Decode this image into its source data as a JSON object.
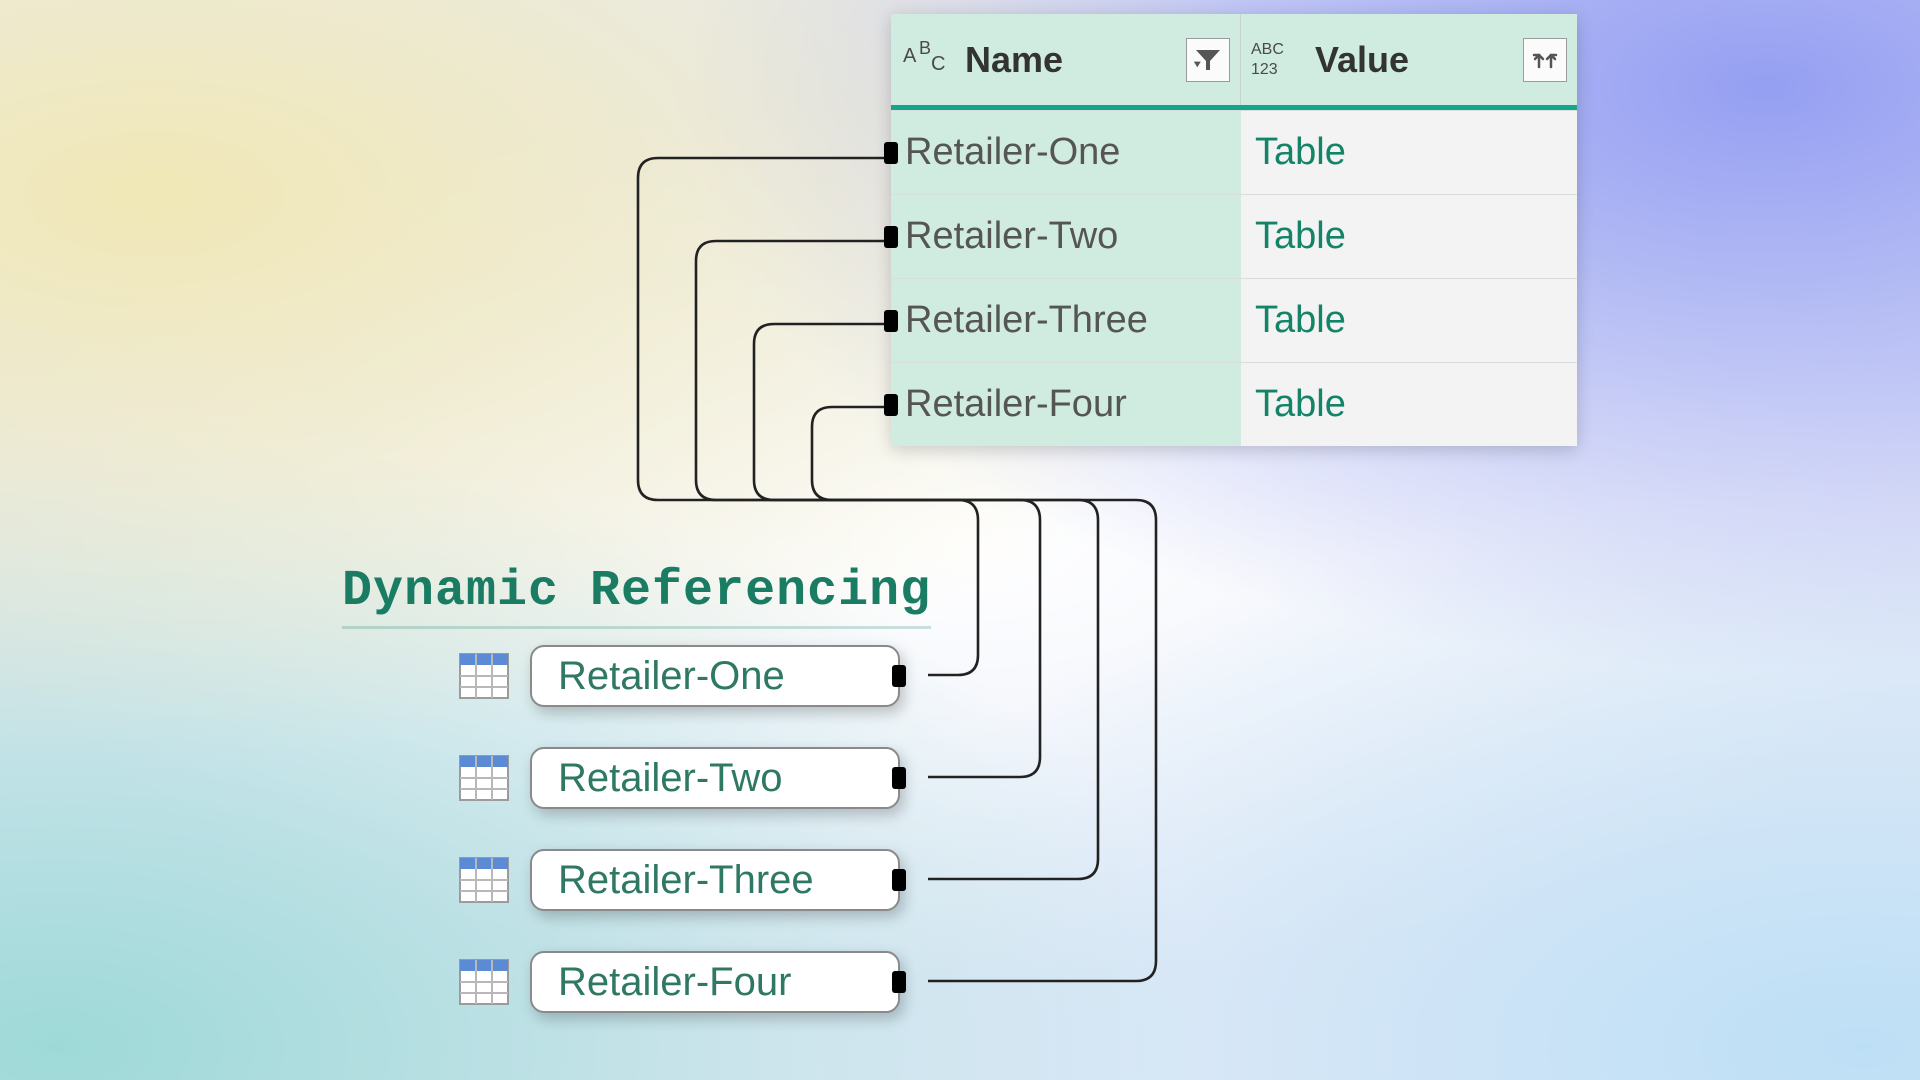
{
  "table": {
    "columns": {
      "name": {
        "label": "Name",
        "type_icon": "ABC"
      },
      "value": {
        "label": "Value",
        "type_icon": "ABC123"
      }
    },
    "rows": [
      {
        "name": "Retailer-One",
        "value": "Table"
      },
      {
        "name": "Retailer-Two",
        "value": "Table"
      },
      {
        "name": "Retailer-Three",
        "value": "Table"
      },
      {
        "name": "Retailer-Four",
        "value": "Table"
      }
    ]
  },
  "heading": "Dynamic Referencing",
  "queries": [
    {
      "label": "Retailer-One"
    },
    {
      "label": "Retailer-Two"
    },
    {
      "label": "Retailer-Three"
    },
    {
      "label": "Retailer-Four"
    }
  ]
}
